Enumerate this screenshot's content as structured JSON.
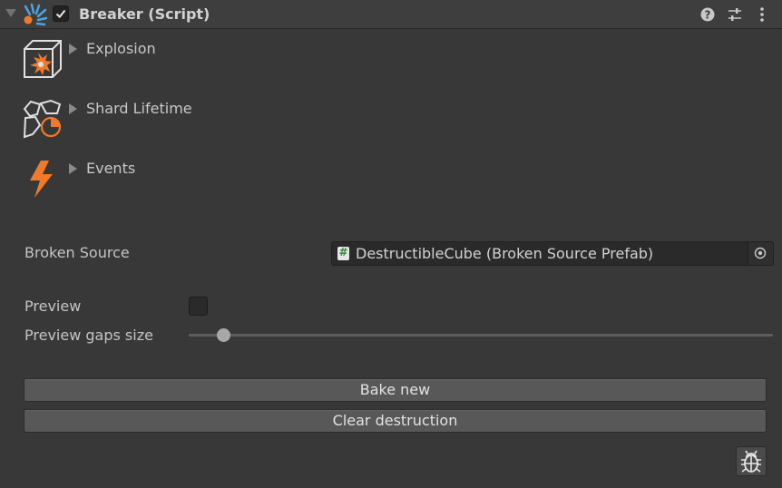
{
  "component": {
    "title": "Breaker (Script)",
    "enabled": true,
    "help_icon": "help-icon",
    "presets_icon": "sliders-icon",
    "menu_icon": "kebab-menu-icon",
    "logo_icon": "breaker-logo-icon"
  },
  "sections": [
    {
      "label": "Explosion",
      "icon": "explosion-cube-icon"
    },
    {
      "label": "Shard Lifetime",
      "icon": "shard-lifetime-icon"
    },
    {
      "label": "Events",
      "icon": "lightning-icon"
    }
  ],
  "fields": {
    "broken_source": {
      "label": "Broken Source",
      "value": "DestructibleCube (Broken Source Prefab)",
      "icon": "script-icon"
    },
    "preview": {
      "label": "Preview",
      "checked": false
    },
    "preview_gaps": {
      "label": "Preview gaps size",
      "value_fraction": 0.05
    }
  },
  "buttons": {
    "bake": "Bake new",
    "clear": "Clear destruction"
  },
  "debug_icon": "bug-icon",
  "colors": {
    "background": "#383838",
    "header": "#3e3e3e",
    "accent_orange": "#f07a2a",
    "accent_blue": "#4ea3e0"
  }
}
